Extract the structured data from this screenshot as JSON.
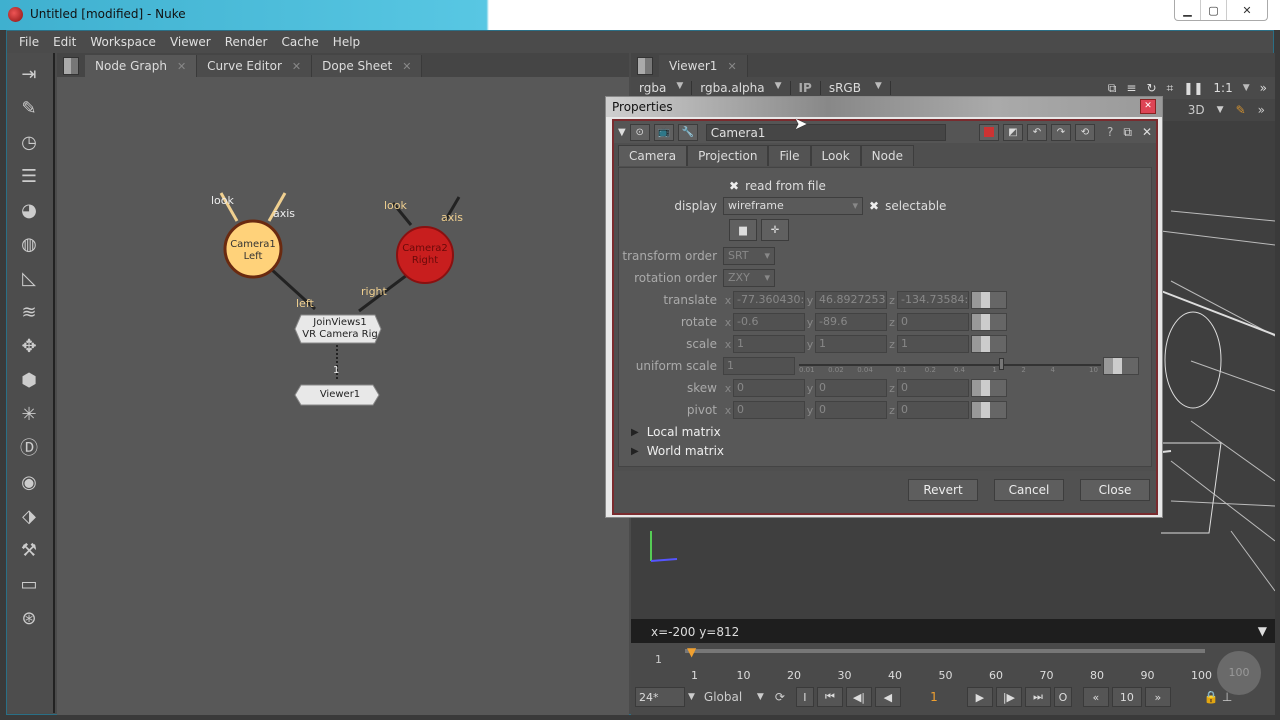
{
  "window": {
    "title": "Untitled [modified] - Nuke",
    "controls": [
      "minimize",
      "maximize",
      "close"
    ]
  },
  "menu": [
    "File",
    "Edit",
    "Workspace",
    "Viewer",
    "Render",
    "Cache",
    "Help"
  ],
  "toolbar_icons": [
    "image-icon",
    "draw-icon",
    "time-icon",
    "channel-icon",
    "color-icon",
    "filter-icon",
    "keyer-icon",
    "merge-icon",
    "transform-icon",
    "3d-icon",
    "particles-icon",
    "deep-icon",
    "views-icon",
    "metadata-icon",
    "toolsets-icon",
    "other-icon",
    "furnace-icon"
  ],
  "left_panel": {
    "tabs": [
      {
        "label": "Node Graph",
        "active": true
      },
      {
        "label": "Curve Editor",
        "active": false
      },
      {
        "label": "Dope Sheet",
        "active": false
      }
    ],
    "nodes": {
      "camera1": {
        "name": "Camera1",
        "label": "Left",
        "color": "#ffd27a",
        "inputs": [
          "look",
          "axis"
        ]
      },
      "camera2": {
        "name": "Camera2",
        "label": "Right",
        "color": "#c81e1e",
        "inputs": [
          "look",
          "axis"
        ]
      },
      "joinviews": {
        "name": "JoinViews1",
        "label": "VR Camera Rig",
        "inputs": [
          "left",
          "right"
        ]
      },
      "viewer": {
        "name": "Viewer1",
        "input_index": "1"
      }
    }
  },
  "viewer": {
    "tab": "Viewer1",
    "channels": "rgba",
    "alpha_channel": "rgba.alpha",
    "ip_label": "IP",
    "lut": "sRGB",
    "zoom": "1:1",
    "view_mode": "3D",
    "status": "x=-200 y=812",
    "timeline": {
      "start": "1",
      "end": "100",
      "current": "1",
      "ticks": [
        "1",
        "10",
        "20",
        "30",
        "40",
        "50",
        "60",
        "70",
        "80",
        "90",
        "100"
      ],
      "fps": "24*",
      "range_mode": "Global",
      "frame": "1",
      "step": "10",
      "in_label": "I",
      "out_label": "O",
      "play_end": "100"
    }
  },
  "properties": {
    "title": "Properties",
    "node_name": "Camera1",
    "tabs": [
      {
        "label": "Camera",
        "active": true
      },
      {
        "label": "Projection"
      },
      {
        "label": "File"
      },
      {
        "label": "Look"
      },
      {
        "label": "Node"
      }
    ],
    "read_from_file": {
      "label": "read from file",
      "checked": true
    },
    "display": {
      "label": "display",
      "value": "wireframe"
    },
    "selectable": {
      "label": "selectable",
      "checked": true
    },
    "transform_order": {
      "label": "transform order",
      "value": "SRT"
    },
    "rotation_order": {
      "label": "rotation order",
      "value": "ZXY"
    },
    "translate": {
      "label": "translate",
      "x": "-77.360430:",
      "y": "46.8927253",
      "z": "-134.73584:"
    },
    "rotate": {
      "label": "rotate",
      "x": "-0.6",
      "y": "-89.6",
      "z": "0"
    },
    "scale": {
      "label": "scale",
      "x": "1",
      "y": "1",
      "z": "1"
    },
    "uniform_scale": {
      "label": "uniform scale",
      "value": "1",
      "slider_ticks": [
        "0.01",
        "0.02",
        "0.04",
        "0.1",
        "0.2",
        "0.4",
        "1",
        "2",
        "4",
        "10"
      ]
    },
    "skew": {
      "label": "skew",
      "x": "0",
      "y": "0",
      "z": "0"
    },
    "pivot": {
      "label": "pivot",
      "x": "0",
      "y": "0",
      "z": "0"
    },
    "sections": [
      "Local matrix",
      "World matrix"
    ],
    "buttons": {
      "revert": "Revert",
      "cancel": "Cancel",
      "close": "Close"
    },
    "axis_labels": {
      "x": "x",
      "y": "y",
      "z": "z"
    }
  }
}
